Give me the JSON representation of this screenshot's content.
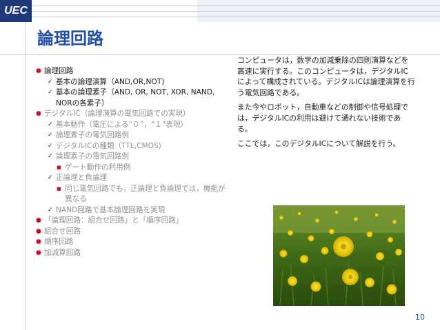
{
  "logo": "UEC",
  "title": "論理回路",
  "bullets": [
    {
      "text": "論理回路",
      "grey": false
    },
    {
      "text": "基本の論理演算（AND,OR,NOT)",
      "grey": false
    },
    {
      "text": "基本の論理素子（AND, OR, NOT, XOR, NAND, NORの各素子）",
      "grey": false
    },
    {
      "text": "デジタルIC（論理演算の電気回路での実現）",
      "grey": true
    },
    {
      "text": "基本動作（電圧による“０”，“１”表現）",
      "grey": true
    },
    {
      "text": "論理素子の電気回路例",
      "grey": true
    },
    {
      "text": "デジタルICの種類（TTL,CMOS)",
      "grey": true
    },
    {
      "text": "論理素子の電気回路例",
      "grey": true
    },
    {
      "text": "ゲート動作の利用例",
      "grey": true
    },
    {
      "text": "正論理と負論理",
      "grey": true
    },
    {
      "text": "同じ電気回路でも，正論理と負論理では，機能が異なる",
      "grey": true
    },
    {
      "text": "NAND回路で基本論理回路を実現",
      "grey": true
    },
    {
      "text": "「論理回路：組合せ回路」と「順序回路」",
      "grey": true
    },
    {
      "text": " 組合せ回路",
      "grey": true
    },
    {
      "text": " 順序回路",
      "grey": true
    },
    {
      "text": " 加減算回路",
      "grey": true
    }
  ],
  "paragraphs": [
    "コンピュータは，数学の加減乗除の四則演算などを高速に実行する。このコンピュータは，デジタルICによって構成されている。デジタルICは論理演算を行う電気回路である。",
    "また今やロボット，自動車などの制御や信号処理では，デジタルICの利用は避けて通れない技術である。",
    "ここでは，このデジタルICについて解説を行う。"
  ],
  "page_number": "10",
  "colors": {
    "accent": "#1f4fa8",
    "bullet": "#d0102a",
    "logo_bg": "#1f3a7a"
  },
  "icons": {
    "bullet": "circle-bullet",
    "sub": "check-mark",
    "subsub": "square-bullet"
  }
}
